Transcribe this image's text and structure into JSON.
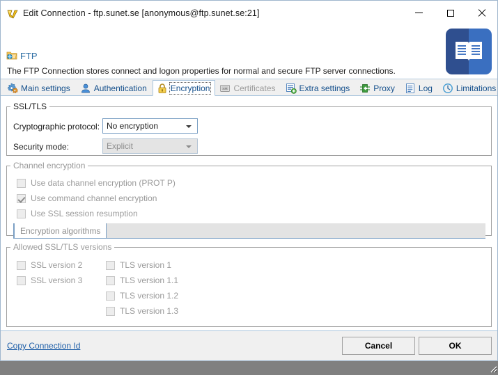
{
  "window": {
    "title": "Edit Connection - ftp.sunet.se [anonymous@ftp.sunet.se:21]",
    "icon": "wing-icon",
    "controls": {
      "minimize": "minimize-icon",
      "maximize": "maximize-icon",
      "close": "close-icon"
    }
  },
  "header": {
    "icon": "ftp-folder-globe-icon",
    "title": "FTP",
    "description": "The FTP Connection stores connect and logon properties for normal and secure FTP server connections.",
    "badge_icon": "manual-book-icon"
  },
  "tabs": [
    {
      "label": "Main settings",
      "icon": "gears-icon",
      "selected": false,
      "disabled": false
    },
    {
      "label": "Authentication",
      "icon": "user-icon",
      "selected": false,
      "disabled": false
    },
    {
      "label": "Encryption",
      "icon": "padlock-icon",
      "selected": true,
      "disabled": false
    },
    {
      "label": "Certificates",
      "icon": "certificate-icon",
      "selected": false,
      "disabled": true
    },
    {
      "label": "Extra settings",
      "icon": "form-plus-icon",
      "selected": false,
      "disabled": false
    },
    {
      "label": "Proxy",
      "icon": "proxy-arrow-icon",
      "selected": false,
      "disabled": false
    },
    {
      "label": "Log",
      "icon": "log-lines-icon",
      "selected": false,
      "disabled": false
    },
    {
      "label": "Limitations",
      "icon": "throttle-icon",
      "selected": false,
      "disabled": false
    }
  ],
  "ssltls": {
    "legend": "SSL/TLS",
    "protocol_label": "Cryptographic protocol:",
    "protocol_value": "No encryption",
    "security_mode_label": "Security mode:",
    "security_mode_value": "Explicit"
  },
  "channel": {
    "legend": "Channel encryption",
    "checkboxes": [
      {
        "label": "Use data channel encryption (PROT P)",
        "checked": false
      },
      {
        "label": "Use command channel encryption",
        "checked": true
      },
      {
        "label": "Use SSL session resumption",
        "checked": false
      }
    ],
    "algorithms_tab": "Encryption algorithms"
  },
  "versions": {
    "legend": "Allowed SSL/TLS versions",
    "left": [
      {
        "label": "SSL version 2",
        "checked": false
      },
      {
        "label": "SSL version 3",
        "checked": false
      }
    ],
    "right": [
      {
        "label": "TLS version 1",
        "checked": false
      },
      {
        "label": "TLS version 1.1",
        "checked": false
      },
      {
        "label": "TLS version 1.2",
        "checked": false
      },
      {
        "label": "TLS version 1.3",
        "checked": false
      }
    ]
  },
  "footer": {
    "copy_link": "Copy Connection Id",
    "cancel_label": "Cancel",
    "ok_label": "OK"
  },
  "colors": {
    "link": "#1f5fa8",
    "tab_text": "#15508c",
    "disabled_text": "#9a9a9a",
    "header_title": "#2b6ca3",
    "badge": "#3a6fc0",
    "window_border": "#9fb6cd"
  }
}
